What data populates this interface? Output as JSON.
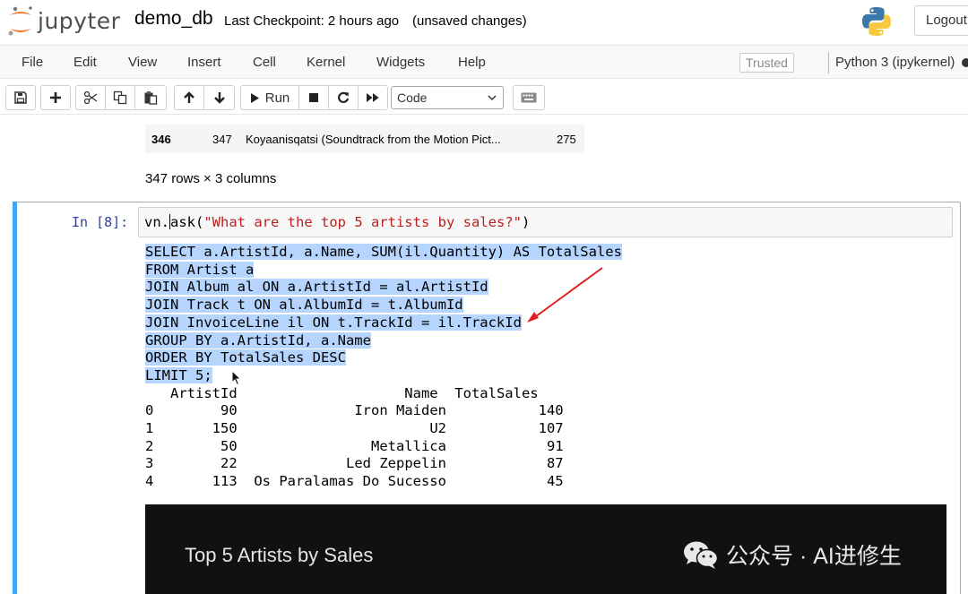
{
  "header": {
    "logo_text": "jupyter",
    "notebook_name": "demo_db",
    "checkpoint": "Last Checkpoint: 2 hours ago",
    "unsaved": "(unsaved changes)",
    "logout_label": "Logout"
  },
  "menubar": {
    "items": [
      "File",
      "Edit",
      "View",
      "Insert",
      "Cell",
      "Kernel",
      "Widgets",
      "Help"
    ],
    "trusted_label": "Trusted",
    "kernel_name": "Python 3 (ipykernel)"
  },
  "toolbar": {
    "run_label": "Run",
    "cell_type": "Code",
    "icons": [
      "save-icon",
      "plus-icon",
      "cut-icon",
      "copy-icon",
      "paste-icon",
      "arrow-up-icon",
      "arrow-down-icon",
      "run-icon",
      "stop-icon",
      "restart-icon",
      "fast-forward-icon",
      "keyboard-icon"
    ]
  },
  "previous_output": {
    "row": {
      "index": "346",
      "id": "347",
      "name": "Koyaanisqatsi (Soundtrack from the Motion Pict...",
      "total": "275"
    },
    "rows_info": "347 rows × 3 columns"
  },
  "cell": {
    "prompt": "In [8]:",
    "code_prefix": "vn.",
    "code_call": "ask",
    "code_open": "(",
    "code_string": "\"What are the top 5 artists by sales?\"",
    "code_close": ")"
  },
  "sql": [
    "SELECT a.ArtistId, a.Name, SUM(il.Quantity) AS TotalSales",
    "FROM Artist a",
    "JOIN Album al ON a.ArtistId = al.ArtistId",
    "JOIN Track t ON al.AlbumId = t.AlbumId",
    "JOIN InvoiceLine il ON t.TrackId = il.TrackId",
    "GROUP BY a.ArtistId, a.Name",
    "ORDER BY TotalSales DESC",
    "LIMIT 5;"
  ],
  "result_table": {
    "columns": [
      "ArtistId",
      "Name",
      "TotalSales"
    ],
    "rows": [
      {
        "index": "0",
        "artist_id": "90",
        "name": "Iron Maiden",
        "total": "140"
      },
      {
        "index": "1",
        "artist_id": "150",
        "name": "U2",
        "total": "107"
      },
      {
        "index": "2",
        "artist_id": "50",
        "name": "Metallica",
        "total": "91"
      },
      {
        "index": "3",
        "artist_id": "22",
        "name": "Led Zeppelin",
        "total": "87"
      },
      {
        "index": "4",
        "artist_id": "113",
        "name": "Os Paralamas Do Sucesso",
        "total": "45"
      }
    ]
  },
  "chart": {
    "title": "Top 5 Artists by Sales"
  },
  "watermark": {
    "text": "公众号 · AI进修生"
  },
  "colors": {
    "prompt": "#303f9f",
    "string": "#ba2121",
    "selection": "#b5d5ff",
    "cell_bar": "#42a5f5",
    "chart_bg": "#111111",
    "arrow": "#e02020"
  }
}
